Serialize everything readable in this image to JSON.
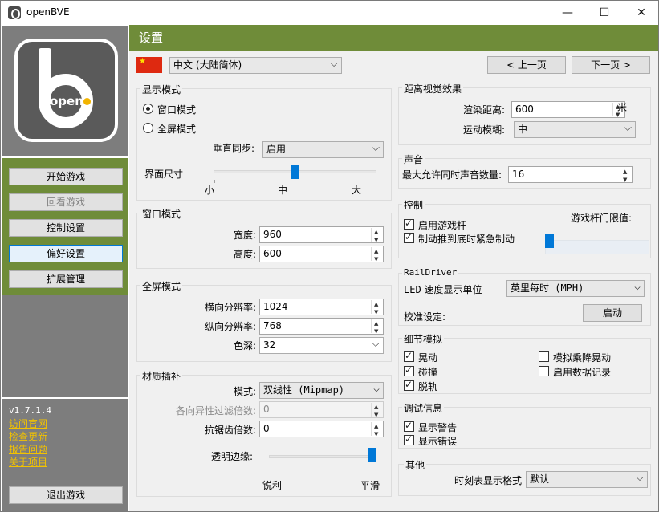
{
  "window": {
    "title": "openBVE",
    "minimize": "—",
    "maximize": "☐",
    "close": "✕"
  },
  "logo": {
    "text": "open"
  },
  "nav": {
    "start": "开始游戏",
    "review": "回看游戏",
    "controls": "控制设置",
    "preferences": "偏好设置",
    "extensions": "扩展管理",
    "quit": "退出游戏"
  },
  "footer": {
    "version": "v1.7.1.4",
    "links": [
      "访问官网",
      "检查更新",
      "报告问题",
      "关于项目"
    ]
  },
  "header": {
    "title": "设置"
  },
  "language": {
    "selected": "中文 (大陆简体)",
    "prev": "< 上一页",
    "next": "下一页 >"
  },
  "display": {
    "title": "显示模式",
    "windowed": "窗口模式",
    "fullscreen": "全屏模式",
    "vsync_label": "垂直同步:",
    "vsync_value": "启用",
    "ui_size_label": "界面尺寸",
    "small": "小",
    "medium": "中",
    "large": "大",
    "ui_size_level": 0.5
  },
  "window_mode": {
    "title": "窗口模式",
    "width_label": "宽度:",
    "width": "960",
    "height_label": "高度:",
    "height": "600"
  },
  "fullscreen": {
    "title": "全屏模式",
    "hres_label": "横向分辨率:",
    "hres": "1024",
    "vres_label": "纵向分辨率:",
    "vres": "768",
    "depth_label": "色深:",
    "depth": "32"
  },
  "texture": {
    "title": "材质插补",
    "mode_label": "模式:",
    "mode": "双线性 (Mipmap)",
    "aniso_label": "各向异性过滤倍数:",
    "aniso": "0",
    "aa_label": "抗锯齿倍数:",
    "aa": "0",
    "transparency_label": "透明边缘:",
    "sharp": "锐利",
    "smooth": "平滑",
    "transparency_level": 1.0
  },
  "distance": {
    "title": "距离视觉效果",
    "render_label": "渲染距离:",
    "render": "600",
    "unit": "米",
    "blur_label": "运动模糊:",
    "blur": "中"
  },
  "sound": {
    "title": "声音",
    "max_label": "最大允许同时声音数量:",
    "max": "16"
  },
  "control": {
    "title": "控制",
    "joystick": "启用游戏杆",
    "emergency": "制动推到底时紧急制动",
    "threshold_label": "游戏杆门限值:",
    "threshold_level": 0.0
  },
  "raildriver": {
    "title": "RailDriver",
    "unit_label": "速度显示单位",
    "unit": "英里每时 (MPH)",
    "calib_label": "校准设定:",
    "calib_button": "启动"
  },
  "detail": {
    "title": "细节模拟",
    "toppling": "晃动",
    "collisions": "碰撞",
    "derail": "脱轨",
    "passenger": "模拟乘降晃动",
    "logging": "启用数据记录"
  },
  "debug": {
    "title": "调试信息",
    "warnings": "显示警告",
    "errors": "显示错误"
  },
  "other": {
    "title": "其他",
    "timetable_label": "时刻表显示格式",
    "timetable": "默认"
  }
}
